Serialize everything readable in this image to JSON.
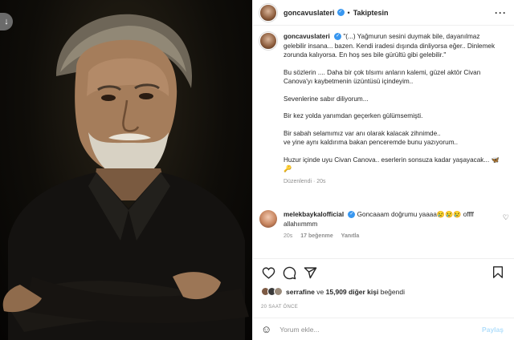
{
  "post": {
    "username": "goncavuslateri",
    "follow_status": "Takiptesin",
    "more_icon": "more-horizontal-icon",
    "download_icon": "download-arrow-icon"
  },
  "caption": {
    "username": "goncavuslateri",
    "paragraphs": [
      "\"(...) Yağmurun sesini duymak bile, dayanılmaz gelebilir insana... bazen. Kendi iradesi dışında dinliyorsa eğer.. Dinlemek zorunda kalıyorsa. En hoş ses bile gürültü gibi gelebilir.\"",
      "Bu sözlerin .... Daha bir çok tılsımı anların kalemi, güzel aktör Civan Canova'yı kaybetmenin üzüntüsü içindeyim..",
      "Sevenlerine sabır diliyorum...",
      "Bir kez yolda yanımdan geçerken gülümsemişti.",
      "Bir sabah selamımız var anı olarak kalacak zihnimde..\nve yine aynı kaldırıma bakan penceremde bunu yazıyorum..",
      "Huzur içinde uyu Civan Canova.. eserlerin sonsuza kadar yaşayacak... 🦋🔑"
    ],
    "edited": "Düzenlendi",
    "age": "20s"
  },
  "comment": {
    "username": "melekbaykalofficial",
    "text": "Goncaaam doğrumu yaaaa😢😢😢 offff allahıımmm",
    "age": "20s",
    "likes": "17 beğenme",
    "reply": "Yanıtla"
  },
  "likes": {
    "first_liker": "serrafine",
    "connector": "ve",
    "others": "15,909 diğer kişi",
    "suffix": "beğendi"
  },
  "timestamp": "20 SAAT ÖNCE",
  "add_comment": {
    "placeholder": "Yorum ekle...",
    "post_label": "Paylaş"
  },
  "colors": {
    "verified": "#3897f0",
    "post_button": "#b2dffc",
    "muted": "#8e8e8e"
  }
}
